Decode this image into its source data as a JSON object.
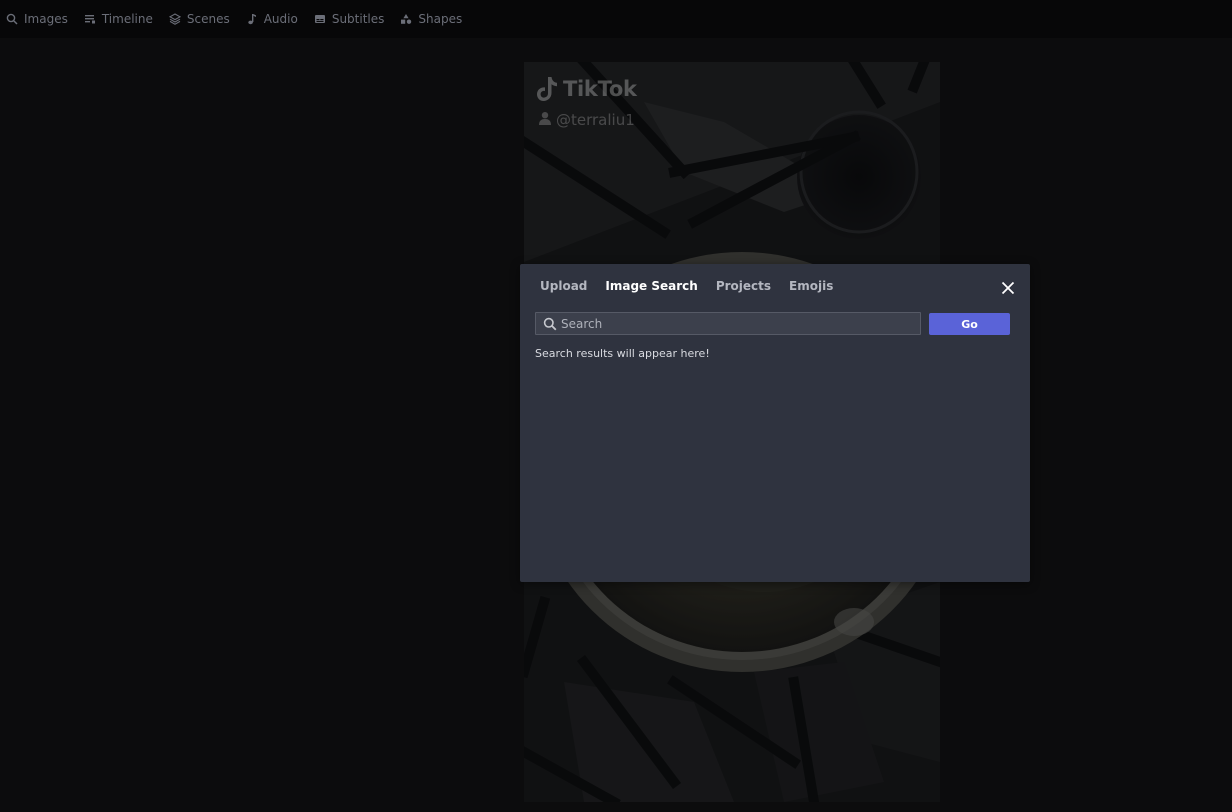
{
  "topbar": {
    "items": [
      {
        "label": "Images",
        "icon": "search-icon"
      },
      {
        "label": "Timeline",
        "icon": "timeline-icon"
      },
      {
        "label": "Scenes",
        "icon": "layers-icon"
      },
      {
        "label": "Audio",
        "icon": "music-note-icon"
      },
      {
        "label": "Subtitles",
        "icon": "subtitles-icon"
      },
      {
        "label": "Shapes",
        "icon": "shapes-icon"
      }
    ]
  },
  "canvas": {
    "watermark": {
      "brand": "TikTok",
      "username": "@terraliu1"
    }
  },
  "modal": {
    "tabs": [
      {
        "label": "Upload",
        "active": false
      },
      {
        "label": "Image Search",
        "active": true
      },
      {
        "label": "Projects",
        "active": false
      },
      {
        "label": "Emojis",
        "active": false
      }
    ],
    "search": {
      "placeholder": "Search",
      "value": ""
    },
    "go_label": "Go",
    "results_message": "Search results will appear here!"
  },
  "colors": {
    "modal_bg": "#2f333f",
    "accent": "#5a63d8",
    "topbar_bg": "#070708"
  }
}
